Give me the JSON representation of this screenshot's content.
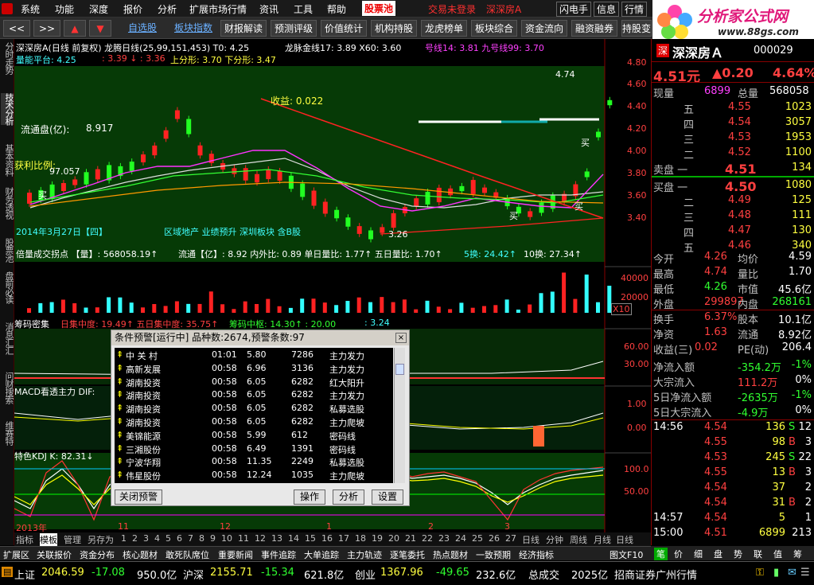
{
  "menu": [
    "系统",
    "功能",
    "深度",
    "报价",
    "分析",
    "扩展市场行情",
    "资讯",
    "工具",
    "帮助"
  ],
  "menu_pool": "股票池",
  "menu_login": "交易未登录",
  "menu_stock": "深深房A",
  "menu_right": [
    "闪电手",
    "信息",
    "行情"
  ],
  "logo": {
    "name": "分析家公式网",
    "url": "www.88gs.com"
  },
  "toolbar": {
    "nav": [
      "<<",
      ">>"
    ],
    "links": [
      "自选股",
      "板块指数"
    ],
    "buttons": [
      "财报解读",
      "预测评级",
      "价值统计",
      "机构持股",
      "龙虎榜单",
      "板块综合",
      "资金流向",
      "融资融券",
      "持股变"
    ]
  },
  "lefttabs": [
    "分时走势",
    "技术分析",
    "基本资料",
    "财务透视",
    "股票池",
    "盘前必读",
    "消息汇汇",
    "问财搜索",
    "维赛特"
  ],
  "chart": {
    "header1": "深深房A(日线 前复权) 龙腾日线(25,99,151,453)  T0: 4.25",
    "header1b": "龙脉金线17: 3.89  X60: 3.60",
    "header1c": "号线14: 3.81  九号线99: 3.70",
    "header2a": "量能平台: 4.25",
    "header2b": ": 3.39 ↓ : 3.36",
    "header2c": "上分形: 3.70  下分形: 3.47",
    "price_ticks": [
      "4.80",
      "4.60",
      "4.40",
      "4.20",
      "4.00",
      "3.80",
      "3.60",
      "3.40"
    ],
    "annot_high": "4.74",
    "annot_low": "3.26",
    "profit_label": "收益: 0.022",
    "float_label": "流通盘(亿):",
    "float_value": "8.917",
    "profit_ratio_label": "获利比例:",
    "profit_ratio_value": "97.057",
    "date_label": "2014年3月27日【四】",
    "sector_label": "区域地产 业绩预升 深圳板块 含B股",
    "buy": "买",
    "vol_header1": "倍量成交拐点 【量】: 568058.19↑",
    "vol_header2": "流通【亿】: 8.92  内外比: 0.89  单日量比: 1.77↑  五日量比: 1.70↑",
    "vol_header3": "5换: 24.42↑",
    "vol_header4": "10换: 27.34↑",
    "vol_ticks": [
      "40000",
      "20000"
    ],
    "vol_unit": "X10",
    "chip_header1": "筹码密集",
    "chip_header2": "日集中度: 19.49↑  五日集中度: 35.75↑",
    "chip_header3": "筹码中枢: 14.30↑  : 20.00",
    "chip_header4": ": 3.24",
    "chip_ticks": [
      "60.00",
      "30.00"
    ],
    "macd_header": "MACD看透主力  DIF:",
    "macd_ticks": [
      "1.00",
      "0.00"
    ],
    "kdj_header": "特色KDJ  K: 82.31↓",
    "kdj_ticks": [
      "100.0",
      "50.00"
    ],
    "xaxis": [
      "2013年",
      "11",
      "12",
      "1",
      "2",
      "3"
    ]
  },
  "dialog": {
    "title": "条件预警[运行中] 品种数:2674,预警条数:97",
    "rows": [
      [
        "中 关 村",
        "01:01",
        "5.80",
        "7286",
        "主力发力"
      ],
      [
        "高新发展",
        "00:58",
        "6.96",
        "3136",
        "主力发力"
      ],
      [
        "湖南投资",
        "00:58",
        "6.05",
        "6282",
        "红大阳升"
      ],
      [
        "湖南投资",
        "00:58",
        "6.05",
        "6282",
        "主力发力"
      ],
      [
        "湖南投资",
        "00:58",
        "6.05",
        "6282",
        "私募选股"
      ],
      [
        "湖南投资",
        "00:58",
        "6.05",
        "6282",
        "主力爬坡"
      ],
      [
        "美锦能源",
        "00:58",
        "5.99",
        "612",
        "密码线"
      ],
      [
        "三湘股份",
        "00:58",
        "6.49",
        "1391",
        "密码线"
      ],
      [
        "宁波华翔",
        "00:58",
        "11.35",
        "2249",
        "私募选股"
      ],
      [
        "伟星股份",
        "00:58",
        "12.24",
        "1035",
        "主力爬坡"
      ]
    ],
    "btn_close": "关闭预警",
    "btn_op": "操作",
    "btn_analysis": "分析",
    "btn_settings": "设置"
  },
  "quote": {
    "flag": "深",
    "name": "深深房Ａ",
    "code": "000029",
    "price": "4.51元",
    "change": "▲0.20",
    "pct": "4.64%",
    "now_label": "现量",
    "now_val": "6899",
    "total_label": "总量",
    "total_val": "568058",
    "asks": [
      [
        "五",
        "4.55",
        "1023"
      ],
      [
        "四",
        "4.54",
        "3057"
      ],
      [
        "三",
        "4.53",
        "1953"
      ],
      [
        "二",
        "4.52",
        "1100"
      ],
      [
        "卖盘 一",
        "4.51",
        "134"
      ]
    ],
    "bids": [
      [
        "买盘 一",
        "4.50",
        "1080"
      ],
      [
        "二",
        "4.49",
        "125"
      ],
      [
        "三",
        "4.48",
        "111"
      ],
      [
        "四",
        "4.47",
        "130"
      ],
      [
        "五",
        "4.46",
        "340"
      ]
    ],
    "stats": [
      [
        "今开",
        "4.26",
        "均价",
        "4.59"
      ],
      [
        "最高",
        "4.74",
        "量比",
        "1.70"
      ],
      [
        "最低",
        "4.26",
        "市值",
        "45.6亿"
      ],
      [
        "外盘",
        "299897",
        "内盘",
        "268161"
      ],
      [
        "换手",
        "6.37%",
        "股本",
        "10.1亿"
      ],
      [
        "净资",
        "1.63",
        "流通",
        "8.92亿"
      ],
      [
        "收益(三)",
        "0.02",
        "PE(动)",
        "206.4"
      ]
    ],
    "flows": [
      [
        "净流入额",
        "-354.2万",
        "-1%"
      ],
      [
        "大宗流入",
        "111.2万",
        "0%"
      ],
      [
        "5日净流入额",
        "-2635万",
        "-1%"
      ],
      [
        "5日大宗流入",
        "-4.9万",
        "0%"
      ]
    ],
    "ticks": [
      [
        "14:56",
        "4.54",
        "136",
        "S",
        "12"
      ],
      [
        "",
        "4.55",
        "98",
        "B",
        "3"
      ],
      [
        "",
        "4.53",
        "245",
        "S",
        "22"
      ],
      [
        "",
        "4.55",
        "13",
        "B",
        "3"
      ],
      [
        "",
        "4.54",
        "37",
        "",
        "2"
      ],
      [
        "",
        "4.54",
        "31",
        "B",
        "2"
      ],
      [
        "14:57",
        "4.54",
        "5",
        "",
        "1"
      ],
      [
        "15:00",
        "4.51",
        "6899",
        "",
        "213"
      ]
    ]
  },
  "bottomtabs": {
    "left": [
      "指标",
      "模板",
      "管理",
      "另存为"
    ],
    "nums": [
      "1",
      "2",
      "3",
      "4",
      "5",
      "6",
      "7",
      "8",
      "9",
      "10",
      "11",
      "12",
      "13",
      "14",
      "15",
      "16",
      "17",
      "18",
      "19",
      "20",
      "21",
      "22",
      "23",
      "24",
      "25",
      "26",
      "27"
    ],
    "periods": [
      "日线",
      "分钟",
      "周线",
      "月线"
    ],
    "right": "日线"
  },
  "funcbar": [
    "扩展区",
    "关联报价",
    "资金分布",
    "核心题材",
    "敢死队席位",
    "重要新闻",
    "事件追踪",
    "大单追踪",
    "主力轨迹",
    "逐笔委托",
    "热点题材",
    "一致预期",
    "经济指标"
  ],
  "funcbar_right": "图文F10",
  "rtabs": [
    "笔",
    "价",
    "细",
    "盘",
    "势",
    "联",
    "值",
    "筹"
  ],
  "status": {
    "sh_label": "上证",
    "sh_val": "2046.59",
    "sh_chg": "-17.08",
    "sh_amt": "950.0亿",
    "hs_label": "沪深",
    "hs_val": "2155.71",
    "hs_chg": "-15.34",
    "hs_amt": "621.8亿",
    "cy_label": "创业",
    "cy_val": "1367.96",
    "cy_chg": "-49.65",
    "cy_amt": "232.6亿",
    "total_label": "总成交",
    "total_val": "2025亿",
    "broker": "招商证券广州行情"
  }
}
